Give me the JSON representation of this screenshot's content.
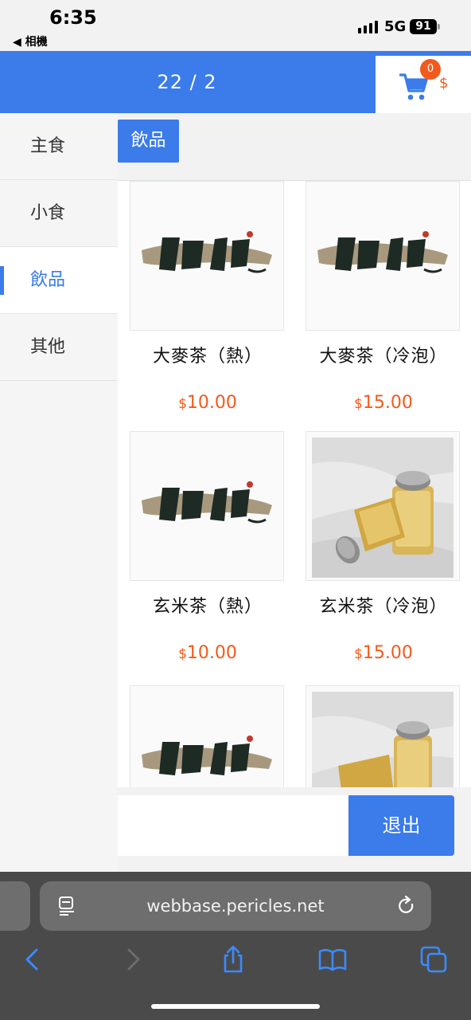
{
  "status_bar": {
    "time": "6:35",
    "back_app": "◀ 相機",
    "network": "5G",
    "battery": "91"
  },
  "header": {
    "page_indicator": "22 / 2",
    "cart_count": "0",
    "cart_total": "$"
  },
  "sidebar": {
    "items": [
      {
        "label": "主食"
      },
      {
        "label": "小食"
      },
      {
        "label": "飲品"
      },
      {
        "label": "其他"
      }
    ],
    "active_index": 2
  },
  "section": {
    "tag": "飲品"
  },
  "products": [
    {
      "name": "大麥茶（熱）",
      "currency": "$",
      "price": "10.00",
      "image": "logo"
    },
    {
      "name": "大麥茶（冷泡）",
      "currency": "$",
      "price": "15.00",
      "image": "logo"
    },
    {
      "name": "玄米茶（熱）",
      "currency": "$",
      "price": "10.00",
      "image": "logo"
    },
    {
      "name": "玄米茶（冷泡）",
      "currency": "$",
      "price": "15.00",
      "image": "tea-bottles-photo"
    },
    {
      "name": "",
      "currency": "",
      "price": "",
      "image": "logo"
    },
    {
      "name": "",
      "currency": "",
      "price": "",
      "image": "tea-bottles-photo"
    }
  ],
  "bottom": {
    "exit_label": "退出"
  },
  "browser": {
    "url": "webbase.pericles.net"
  },
  "colors": {
    "accent": "#3b7bea",
    "price": "#f25a1c",
    "badge": "#f25a1c"
  }
}
